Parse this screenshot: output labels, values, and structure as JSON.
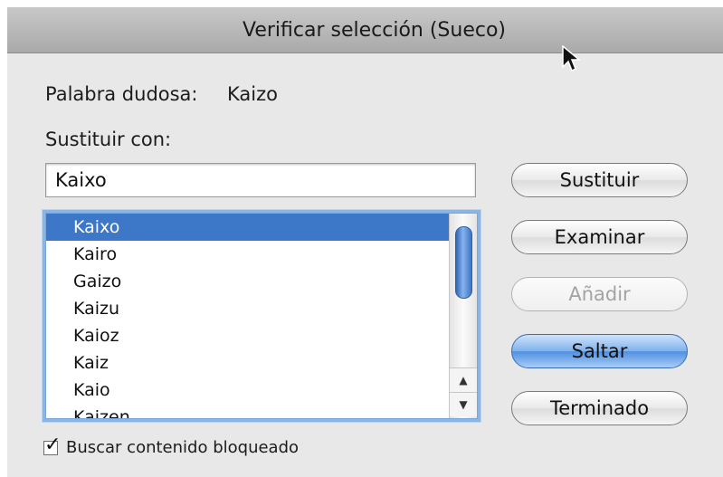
{
  "dialog": {
    "title": "Verificar selección (Sueco)",
    "doubtful_label": "Palabra dudosa:",
    "doubtful_word": "Kaizo",
    "replace_label": "Sustituir con:",
    "replace_value": "Kaixo"
  },
  "suggestions": {
    "items": [
      "Kaixo",
      "Kairo",
      "Gaizo",
      "Kaizu",
      "Kaioz",
      "Kaiz",
      "Kaio",
      "Kaizen"
    ],
    "selected": "Kaixo"
  },
  "buttons": {
    "replace": "Sustituir",
    "browse": "Examinar",
    "add": "Añadir",
    "skip": "Saltar",
    "done": "Terminado"
  },
  "options": {
    "search_locked_label": "Buscar contenido bloqueado",
    "search_locked_checked": true
  },
  "colors": {
    "selection": "#3d77c8",
    "default_button": "#5b98e2"
  },
  "icons": [
    "checkmark-icon",
    "arrow-up-icon",
    "arrow-down-icon",
    "mouse-cursor-icon"
  ]
}
